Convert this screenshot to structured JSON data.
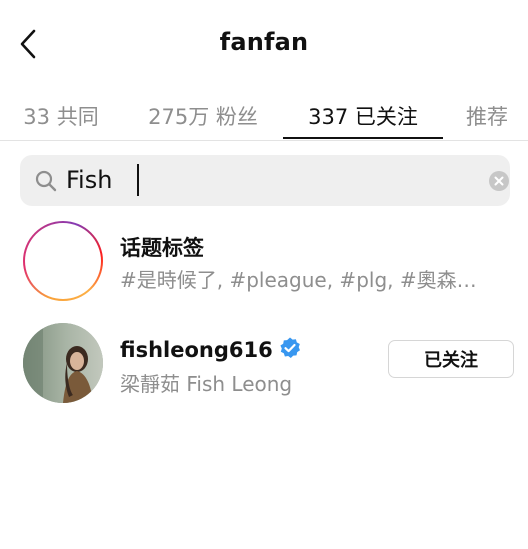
{
  "header": {
    "title": "fanfan",
    "back_icon": "chevron-left-icon"
  },
  "tabs": [
    {
      "label": "33 共同",
      "active": false
    },
    {
      "label": "275万 粉丝",
      "active": false
    },
    {
      "label": "337 已关注",
      "active": true
    },
    {
      "label": "推荐",
      "active": false
    }
  ],
  "search": {
    "value": "Fish",
    "icon": "search-icon",
    "clear_icon": "clear-icon"
  },
  "results": [
    {
      "type": "hashtag",
      "title": "话题标签",
      "subtitle": "#是時候了, #pleague, #plg, #奧森運動公園",
      "icon": "hashtag-icon"
    },
    {
      "type": "user",
      "username": "fishleong616",
      "verified": true,
      "full_name": "梁靜茹 Fish Leong",
      "follow_button": "已关注",
      "icon": "verified-badge-icon"
    }
  ],
  "colors": {
    "verified_blue": "#3897f0",
    "secondary_text": "#8e8e8e",
    "search_bg": "#efefef"
  }
}
